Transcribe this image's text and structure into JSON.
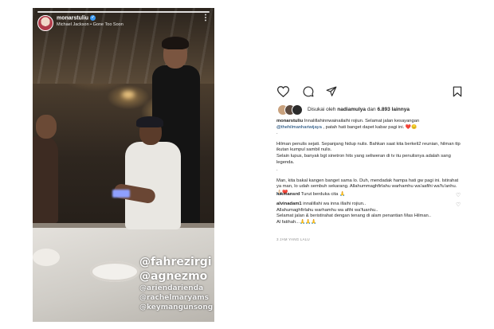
{
  "story": {
    "username": "monarstuliu",
    "music": "Michael Jackson • Gone Too Soon",
    "tags": [
      "@fahrezirgi",
      "@agnezmo",
      "@ariendarienda",
      "@rachelmaryams",
      "@keymangunsong"
    ]
  },
  "post": {
    "liked_by_prefix": "Disukai oleh",
    "liked_by_user": "nadiamulya",
    "liked_by_joiner": "dan",
    "liked_by_count": "6.893 lainnya",
    "caption_user": "monarstuliu",
    "caption_p1_a": "Innalillahinnwainailaihi rojiun. Selamat jalan kesayangan ",
    "caption_mention": "@thehilmanhariwijaya",
    "caption_p1_b": " , patah hati banget dapet kabar pagi ini. ",
    "caption_p1_emoji": "❤️😔",
    "caption_dot1": ".",
    "caption_p2": "Hilman penulis sejati. Sepanjang hidup nulis. Bahkan saat kita berkeli2 reunian, hilman ttp ikutan kumpul sambil nulis.",
    "caption_p3": "Selain lupus, banyak bgt sinetron hits yang seliweran di tv itu penulisnya adalah sang legenda.",
    "caption_dot2": ".",
    "caption_p4": "Man, kita bakal kangen banget sama lo. Duh, mendadak hampa hati gw pagi ini. Istirahat ya man, lo udah sembuh sekarang. Allahummaghfirlahu warhamhu wa'aafihi wa'fu'anhu. ",
    "caption_p4_emoji": "🙏🏻❤️",
    "comments": [
      {
        "user": "lukmansrd",
        "text": "Turut berduka cita 🙏"
      },
      {
        "user": "alvinadam1",
        "text": "innalillahi wa inna illaihi rojiun..",
        "lines": [
          "Allahumaghfirlahu warhamhu wa afihi wa'fuanhu..",
          "Selamat jalan & beristirahat dengan tenang di alam penantian Mas Hilman..",
          "Al fatihah...🙏🙏🙏"
        ]
      }
    ],
    "time_ago": "3 JAM YANG LALU"
  },
  "icons": [
    "heart-icon",
    "comment-icon",
    "share-icon",
    "bookmark-icon",
    "more-icon",
    "verified-icon"
  ],
  "colors": {
    "mention": "#00376b",
    "heart": "#ed4956",
    "verified": "#3897f0",
    "muted": "#8e8e8e"
  }
}
